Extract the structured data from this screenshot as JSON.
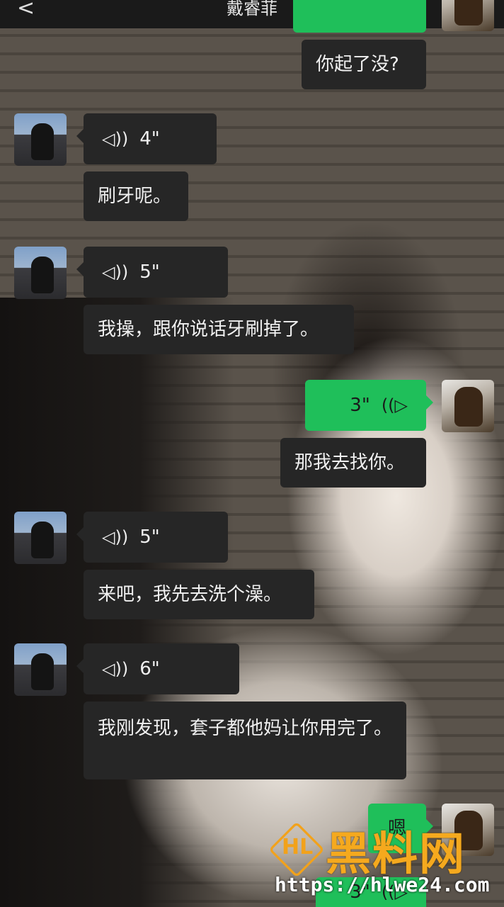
{
  "header": {
    "title": "戴睿菲",
    "back_glyph": "<",
    "more_glyph": "···"
  },
  "messages": [
    {
      "side": "right",
      "type": "text",
      "text": "你起了没?"
    },
    {
      "side": "left",
      "type": "voice",
      "duration": "4\""
    },
    {
      "side": "left",
      "type": "text",
      "text": "刷牙呢。"
    },
    {
      "side": "left",
      "type": "voice",
      "duration": "5\""
    },
    {
      "side": "left",
      "type": "text",
      "text": "我操，跟你说话牙刷掉了。"
    },
    {
      "side": "right",
      "type": "voice",
      "duration": "3\""
    },
    {
      "side": "right",
      "type": "text",
      "text": "那我去找你。"
    },
    {
      "side": "left",
      "type": "voice",
      "duration": "5\""
    },
    {
      "side": "left",
      "type": "text",
      "text": "来吧，我先去洗个澡。"
    },
    {
      "side": "left",
      "type": "voice",
      "duration": "6\""
    },
    {
      "side": "left",
      "type": "text",
      "text": "我刚发现，套子都他妈让你用完了。"
    },
    {
      "side": "right",
      "type": "text",
      "text": "嗯"
    },
    {
      "side": "right",
      "type": "voice",
      "duration": "3\""
    }
  ],
  "watermark": {
    "logo_text": "HL",
    "name": "黑料网",
    "url": "https://hlwe24.com"
  },
  "colors": {
    "accent_green": "#1fbf5a",
    "dark_bubble": "#262626",
    "watermark_orange": "#f5a91e"
  },
  "icons": {
    "voice": "sound-wave-icon",
    "back": "chevron-left-icon",
    "more": "more-dots-icon"
  }
}
